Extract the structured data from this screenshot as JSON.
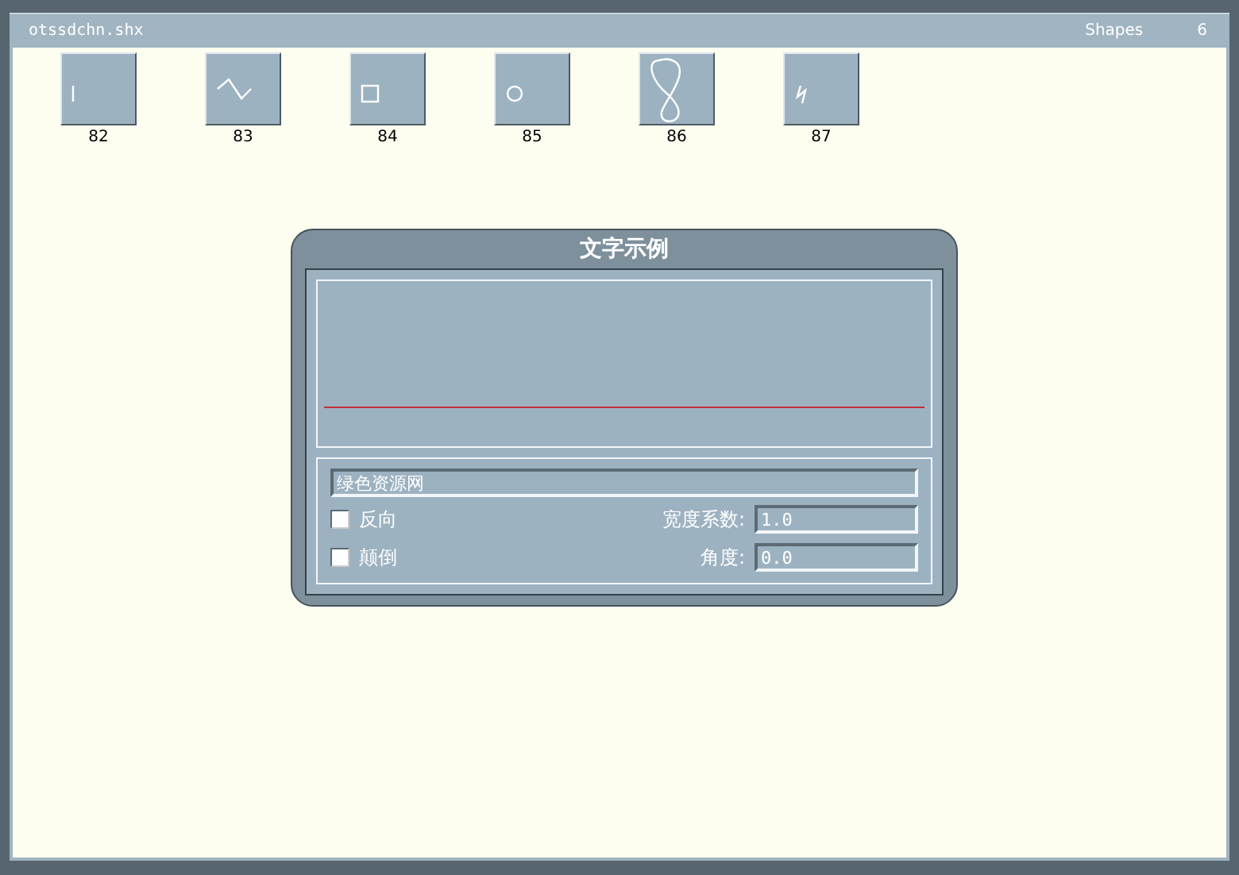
{
  "header": {
    "file_name": "otssdchn.shx",
    "label": "Shapes",
    "count": "6"
  },
  "shapes": [
    {
      "kind": "line",
      "number": "82"
    },
    {
      "kind": "wave",
      "number": "83"
    },
    {
      "kind": "square",
      "number": "84"
    },
    {
      "kind": "circle",
      "number": "85"
    },
    {
      "kind": "loop",
      "number": "86"
    },
    {
      "kind": "zigzag",
      "number": "87"
    }
  ],
  "dialog": {
    "title": "文字示例",
    "text_value": "绿色资源网",
    "options": [
      {
        "label": "反向",
        "checked": false
      },
      {
        "label": "颠倒",
        "checked": false
      }
    ],
    "fields": [
      {
        "label": "宽度系数:",
        "value": "1.0"
      },
      {
        "label": "角度:",
        "value": "0.0"
      }
    ]
  }
}
